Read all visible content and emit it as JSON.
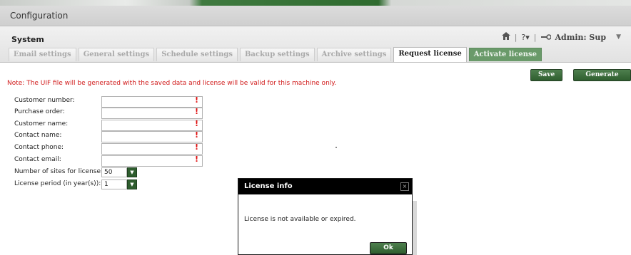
{
  "window": {
    "title": "Configuration"
  },
  "section": {
    "title": "System"
  },
  "header": {
    "help_label": "?▾",
    "user_label": "Admin: Sup",
    "user_caret": "▼"
  },
  "tabs": [
    {
      "label": "Email settings"
    },
    {
      "label": "General settings"
    },
    {
      "label": "Schedule settings"
    },
    {
      "label": "Backup settings"
    },
    {
      "label": "Archive settings"
    },
    {
      "label": "Request license"
    },
    {
      "label": "Activate license"
    }
  ],
  "toolbar": {
    "save_label": "Save",
    "generate_label": "Generate UIF"
  },
  "note": "Note: The UIF file will be generated with the saved data and license will be valid for this machine only.",
  "form": {
    "fields": [
      {
        "label": "Customer number:",
        "value": ""
      },
      {
        "label": "Purchase order:",
        "value": ""
      },
      {
        "label": "Customer name:",
        "value": ""
      },
      {
        "label": "Contact name:",
        "value": ""
      },
      {
        "label": "Contact phone:",
        "value": ""
      },
      {
        "label": "Contact email:",
        "value": ""
      }
    ],
    "required_mark": "!",
    "sites": {
      "label": "Number of sites for license:",
      "value": "50"
    },
    "period": {
      "label": "License period (in year(s)):",
      "value": "1"
    }
  },
  "dialog": {
    "title": "License info",
    "close": "×",
    "message": "License is not available or expired.",
    "ok_label": "Ok"
  },
  "colors": {
    "accent_green": "#2f5e2f",
    "note_red": "#d11a1a",
    "dialog_header": "#000000"
  }
}
